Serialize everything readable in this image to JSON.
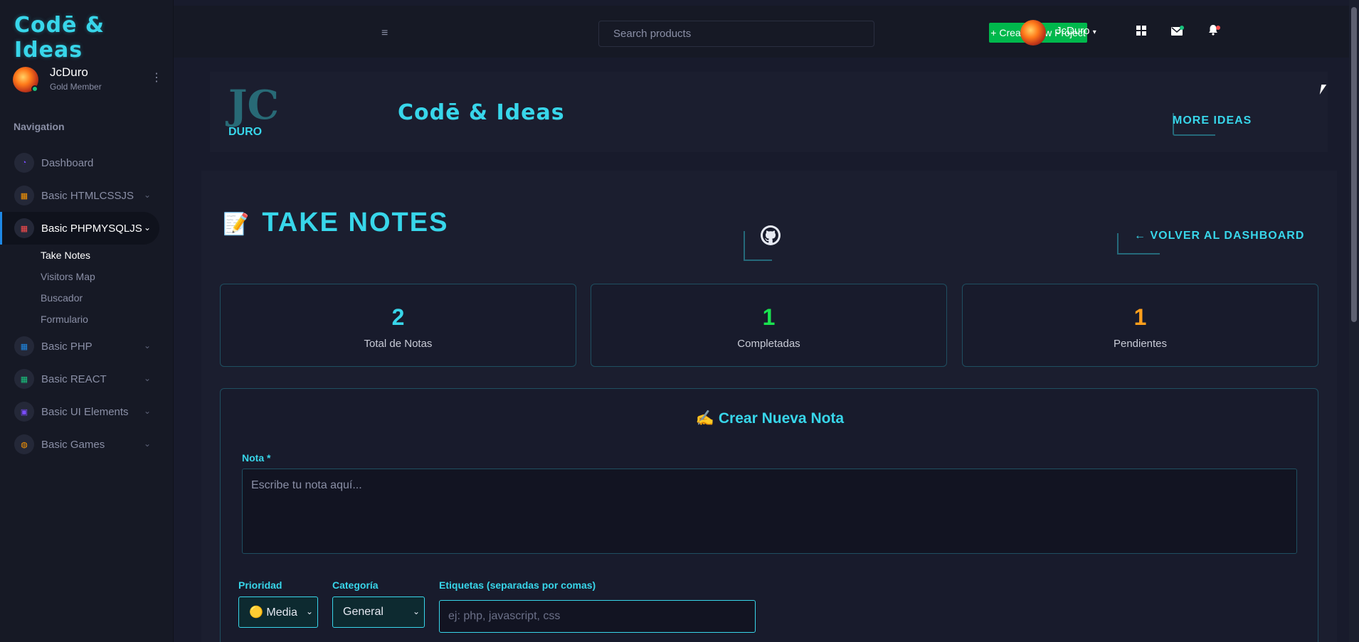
{
  "brand": {
    "logo_text": "Codē & Ideas"
  },
  "profile": {
    "name": "JcDuro",
    "role": "Gold Member"
  },
  "sidebar": {
    "nav_title": "Navigation",
    "items": [
      {
        "label": "Dashboard",
        "icon": "gauge-icon",
        "color": "#7c4dff"
      },
      {
        "label": "Basic HTMLCSSJS",
        "icon": "grid-icon",
        "color": "#ff9800"
      },
      {
        "label": "Basic PHPMYSQLJS",
        "icon": "grid-icon",
        "color": "#ff4d4d"
      },
      {
        "label": "Basic PHP",
        "icon": "grid-icon",
        "color": "#1e88e5"
      },
      {
        "label": "Basic REACT",
        "icon": "grid-icon",
        "color": "#19c37d"
      },
      {
        "label": "Basic UI Elements",
        "icon": "ui-icon",
        "color": "#7c4dff"
      },
      {
        "label": "Basic Games",
        "icon": "gamepad-icon",
        "color": "#ff9800"
      }
    ],
    "sub_items": [
      "Take Notes",
      "Visitors Map",
      "Buscador",
      "Formulario"
    ]
  },
  "header": {
    "search_placeholder": "Search products",
    "create_label": "+ Create New Project",
    "user_name": "JcDuro"
  },
  "banner": {
    "logo_letters": "JC",
    "logo_sub": "DURO",
    "title": "Codē & Ideas",
    "more_ideas": "MORE IDEAS"
  },
  "page": {
    "title": "TAKE NOTES",
    "back_label": "← VOLVER AL DASHBOARD"
  },
  "stats": [
    {
      "value": "2",
      "label": "Total de Notas",
      "color": "#38d6ea"
    },
    {
      "value": "1",
      "label": "Completadas",
      "color": "#19e34f"
    },
    {
      "value": "1",
      "label": "Pendientes",
      "color": "#ff9f1c"
    }
  ],
  "form": {
    "title": "✍️ Crear Nueva Nota",
    "note_label": "Nota *",
    "note_placeholder": "Escribe tu nota aquí...",
    "priority_label": "Prioridad",
    "priority_value": "🟡 Media",
    "category_label": "Categoría",
    "category_value": "General",
    "tags_label": "Etiquetas (separadas por comas)",
    "tags_placeholder": "ej: php, javascript, css"
  }
}
